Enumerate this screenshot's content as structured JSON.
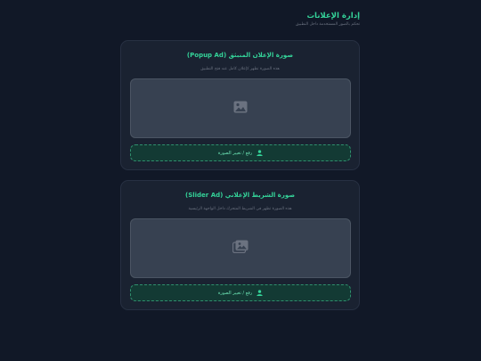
{
  "header": {
    "title": "إدارة الإعلانات",
    "subtitle": "تحكم بالصور المستخدمة داخل التطبيق"
  },
  "cards": [
    {
      "title": "صورة الإعلان المنبثق (Popup Ad)",
      "description": "هذه الصورة تظهر كإعلان كامل عند فتح التطبيق",
      "upload_label": "رفع / تغيير الصورة",
      "placeholder_icon": "image-icon"
    },
    {
      "title": "صورة الشريط الإعلاني (Slider Ad)",
      "description": "هذه الصورة تظهر في الشريط المتحرك داخل الواجهة الرئيسية",
      "upload_label": "رفع / تغيير الصورة",
      "placeholder_icon": "images-icon"
    }
  ],
  "colors": {
    "background": "#111827",
    "card": "#1a2231",
    "accent": "#34d399",
    "image_placeholder": "#374151",
    "button_bg": "#133a34"
  }
}
